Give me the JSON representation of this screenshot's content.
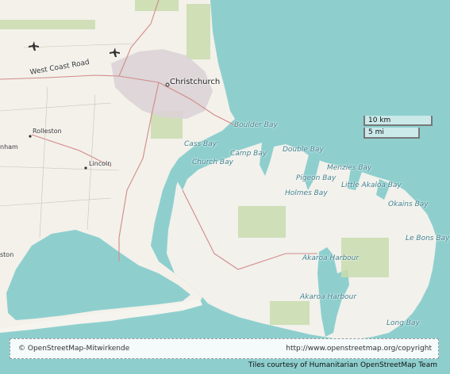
{
  "places": {
    "christchurch": "Christchurch",
    "rolleston": "Rolleston",
    "lincoln": "Lincoln",
    "nham": "nham",
    "ston": "ston"
  },
  "roads": {
    "west_coast_road": "West Coast Road"
  },
  "water": {
    "boulder_bay": "Boulder Bay",
    "cass_bay": "Cass Bay",
    "camp_bay": "Camp Bay",
    "church_bay": "Church Bay",
    "double_bay": "Double Bay",
    "menzies_bay": "Menzies Bay",
    "pigeon_bay": "Pigeon Bay",
    "little_akaloa_bay": "Little Akaloa Bay",
    "holmes_bay": "Holmes Bay",
    "okains_bay": "Okains Bay",
    "le_bons_bay": "Le Bons Bay",
    "akaroa_harbour_1": "Akaroa Harbour",
    "akaroa_harbour_2": "Akaroa Harbour",
    "long_bay": "Long Bay"
  },
  "scale": {
    "km": "10 km",
    "mi": "5 mi"
  },
  "attribution": {
    "left": "© OpenStreetMap-Mitwirkende",
    "right": "http://www.openstreetmap.org/copyright"
  },
  "tiles_credit": "Tiles courtesy of Humanitarian OpenStreetMap Team",
  "colors": {
    "water": "#8ecfce",
    "land": "#f3f1ea",
    "road": "#d28a8a"
  }
}
